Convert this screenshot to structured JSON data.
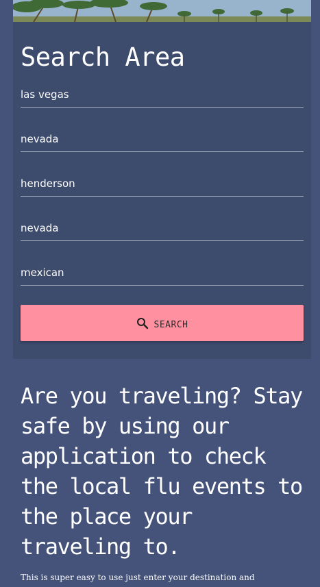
{
  "search_area": {
    "title": "Search Area",
    "fields": [
      {
        "value": "las vegas"
      },
      {
        "value": "nevada"
      },
      {
        "value": "henderson"
      },
      {
        "value": "nevada"
      },
      {
        "value": "mexican"
      }
    ],
    "search_button": {
      "label": "SEARCH",
      "icon": "search-icon"
    }
  },
  "info": {
    "headline": "Are you traveling? Stay safe by using our application to check the local flu events to the place your traveling to.",
    "body": "This is super easy to use just enter your destination and"
  },
  "colors": {
    "page_background": "#45537a",
    "card_background": "#3d4b6d",
    "button_background": "#ff909f",
    "text": "#ffffff"
  }
}
